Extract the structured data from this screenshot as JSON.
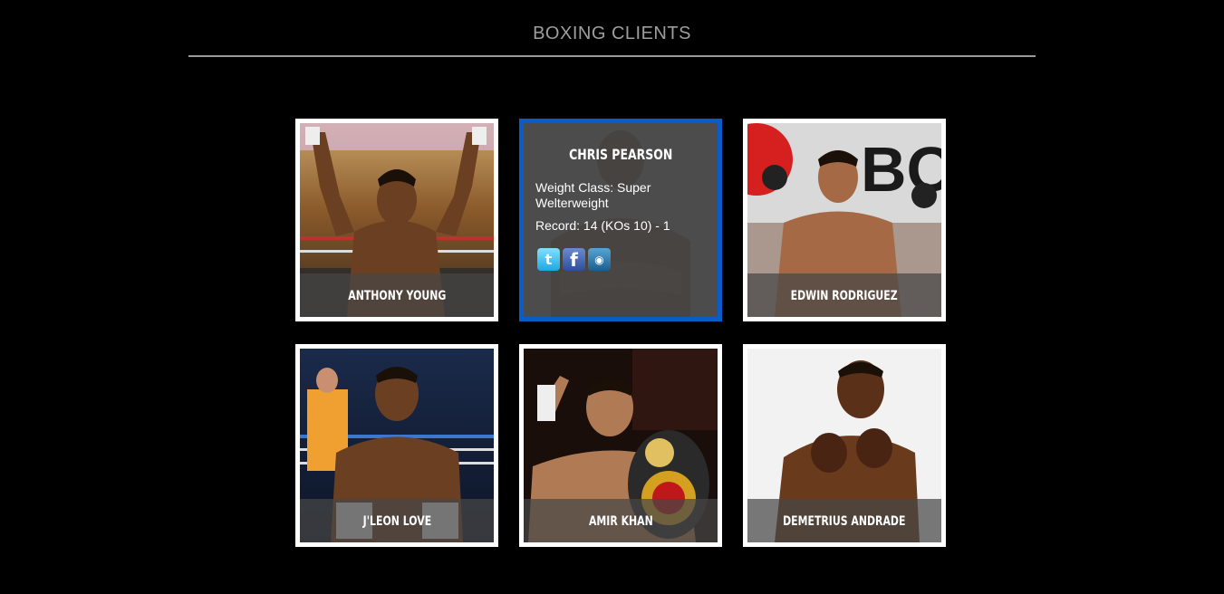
{
  "header": {
    "title": "BOXING CLIENTS"
  },
  "clients": [
    {
      "name": "ANTHONY YOUNG"
    },
    {
      "name": "CHRIS PEARSON",
      "weight_class": "Weight Class: Super Welterweight",
      "record": "Record: 14 (KOs 10) - 1"
    },
    {
      "name": "EDWIN RODRIGUEZ"
    },
    {
      "name": "J'LEON LOVE"
    },
    {
      "name": "AMIR KHAN"
    },
    {
      "name": "DEMETRIUS ANDRADE"
    }
  ],
  "icons": {
    "twitter": "twitter-icon",
    "facebook": "facebook-icon",
    "instagram": "instagram-icon"
  }
}
